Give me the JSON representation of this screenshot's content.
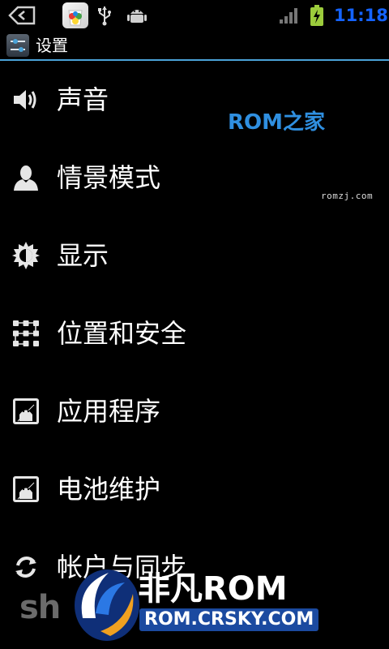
{
  "status_bar": {
    "time": "11:18",
    "icons": [
      "back-arrow-icon",
      "app-store-icon",
      "usb-icon",
      "android-debug-icon",
      "signal-strength-icon",
      "battery-charging-icon"
    ],
    "time_color": "#1463ff"
  },
  "title_bar": {
    "icon": "settings-sliders-icon",
    "title": "设置",
    "accent_color": "#4aa3d8"
  },
  "settings_items": [
    {
      "label": "声音",
      "icon": "speaker-icon"
    },
    {
      "label": "情景模式",
      "icon": "person-profile-icon"
    },
    {
      "label": "显示",
      "icon": "brightness-icon"
    },
    {
      "label": "位置和安全",
      "icon": "location-grid-icon"
    },
    {
      "label": "应用程序",
      "icon": "android-app-icon"
    },
    {
      "label": "电池维护",
      "icon": "android-battery-icon"
    },
    {
      "label": "帐户与同步",
      "icon": "sync-icon"
    }
  ],
  "watermarks": {
    "rom_home_logo": "ROM之家",
    "rom_home_url": "romzj.com",
    "crsky_brand": "非凡ROM",
    "crsky_url": "ROM.CRSKY.COM",
    "shouji_text": "sh"
  }
}
